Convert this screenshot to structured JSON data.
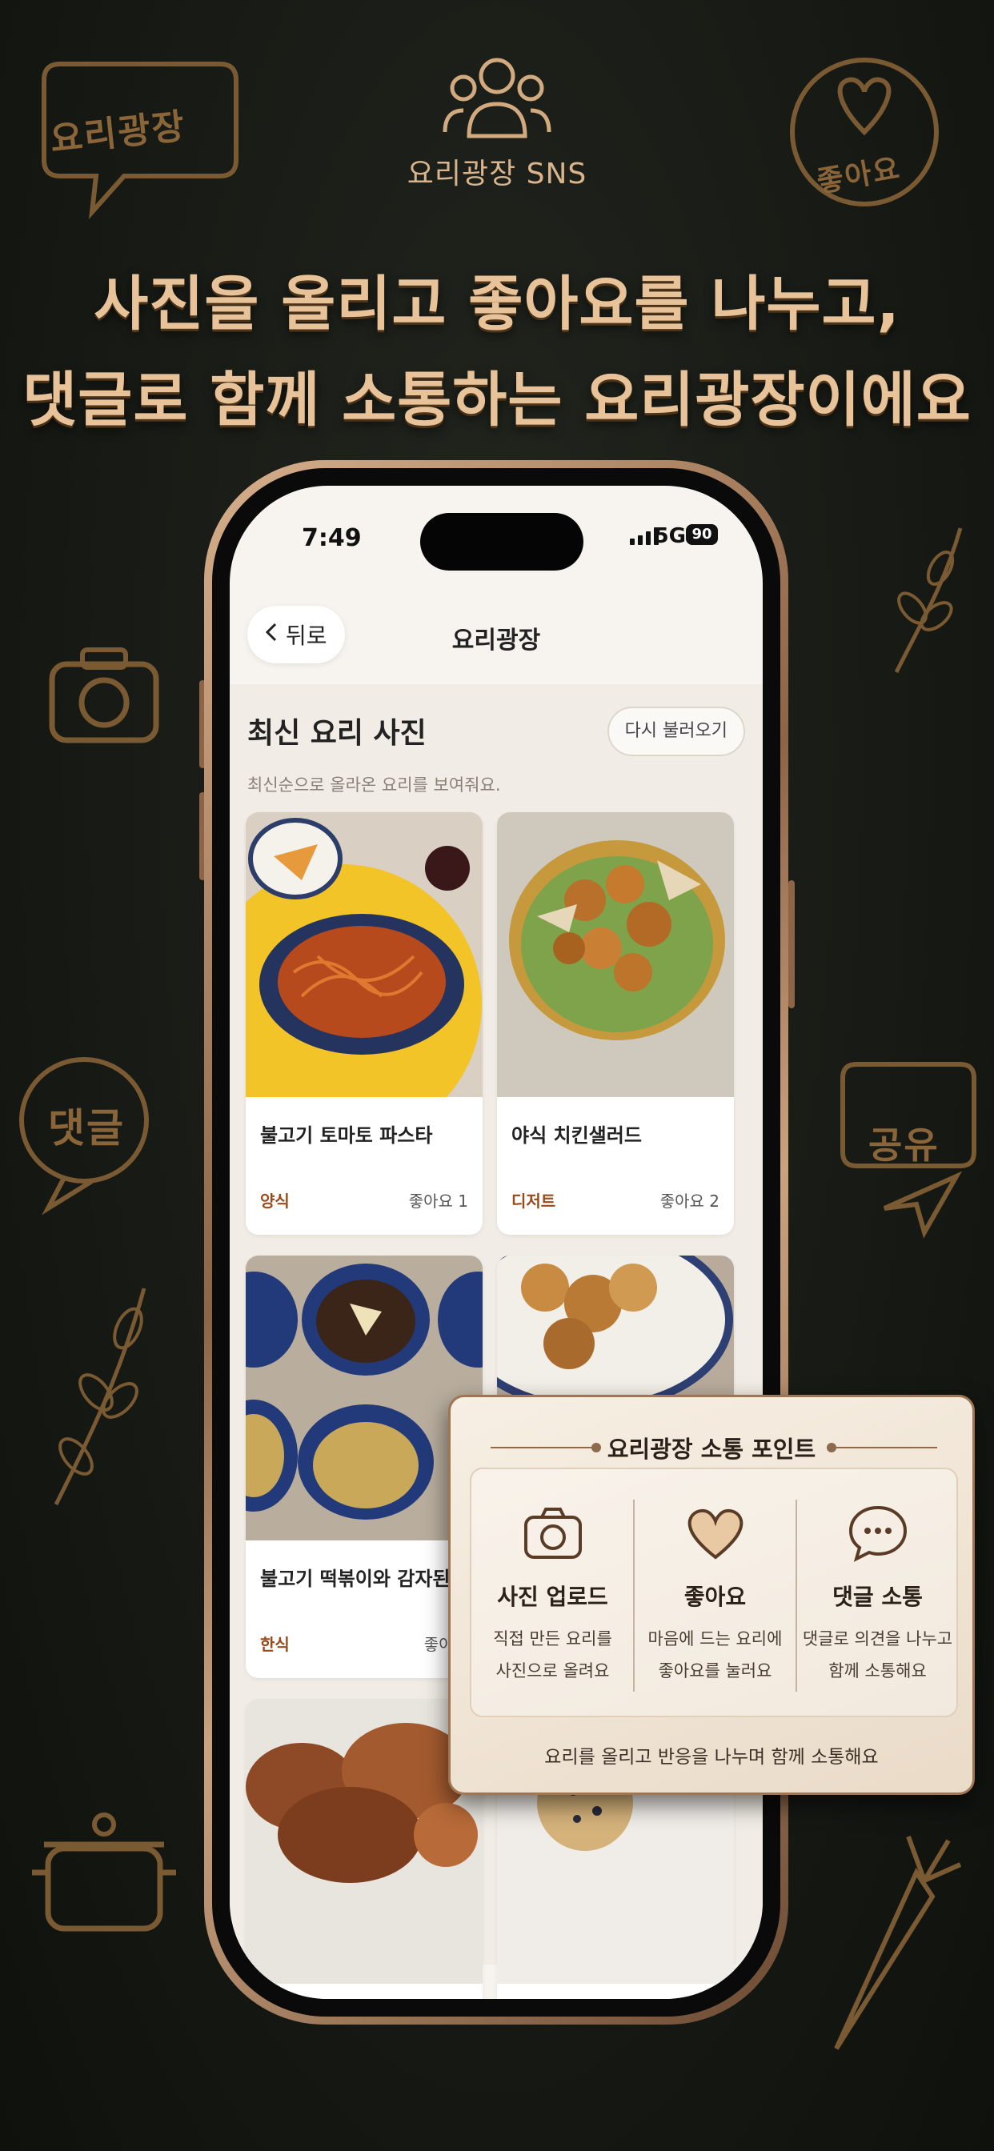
{
  "header": {
    "app_label": "요리광장 SNS",
    "headline_line1": "사진을 올리고 좋아요를 나누고,",
    "headline_line2": "댓글로 함께 소통하는 요리광장이에요"
  },
  "decor": {
    "badge_top_left": "요리광장",
    "badge_top_right": "좋아요",
    "badge_left": "댓글",
    "badge_right": "공유"
  },
  "status_bar": {
    "time": "7:49",
    "network": "5G",
    "battery": "90"
  },
  "nav": {
    "back_label": "뒤로",
    "title": "요리광장"
  },
  "section": {
    "title": "최신 요리 사진",
    "reload_label": "다시 불러오기",
    "description": "최신순으로 올라온 요리를 보여줘요."
  },
  "posts": [
    {
      "title": "불고기 토마토 파스타",
      "category": "양식",
      "likes": "좋아요 1"
    },
    {
      "title": "야식 치킨샐러드",
      "category": "디저트",
      "likes": "좋아요 2"
    },
    {
      "title": "불고기 떡볶이와 감자된장국",
      "category": "한식",
      "likes": "좋아요"
    },
    {
      "title": "",
      "category": "",
      "likes": ""
    },
    {
      "title": "",
      "category": "",
      "likes": ""
    },
    {
      "title": "",
      "category": "",
      "likes": ""
    }
  ],
  "feature_panel": {
    "title": "요리광장 소통 포인트",
    "features": [
      {
        "name": "사진 업로드",
        "icon": "camera-icon",
        "line1": "직접 만든 요리를",
        "line2": "사진으로 올려요"
      },
      {
        "name": "좋아요",
        "icon": "heart-icon",
        "line1": "마음에 드는 요리에",
        "line2": "좋아요를 눌러요"
      },
      {
        "name": "댓글 소통",
        "icon": "comment-icon",
        "line1": "댓글로 의견을 나누고",
        "line2": "함께 소통해요"
      }
    ],
    "footer": "요리를 올리고 반응을 나누며 함께 소통해요"
  },
  "colors": {
    "background": "#151713",
    "gold": "#e8c39a",
    "accent_brown": "#9a4a18",
    "panel": "#f3e9dc"
  }
}
